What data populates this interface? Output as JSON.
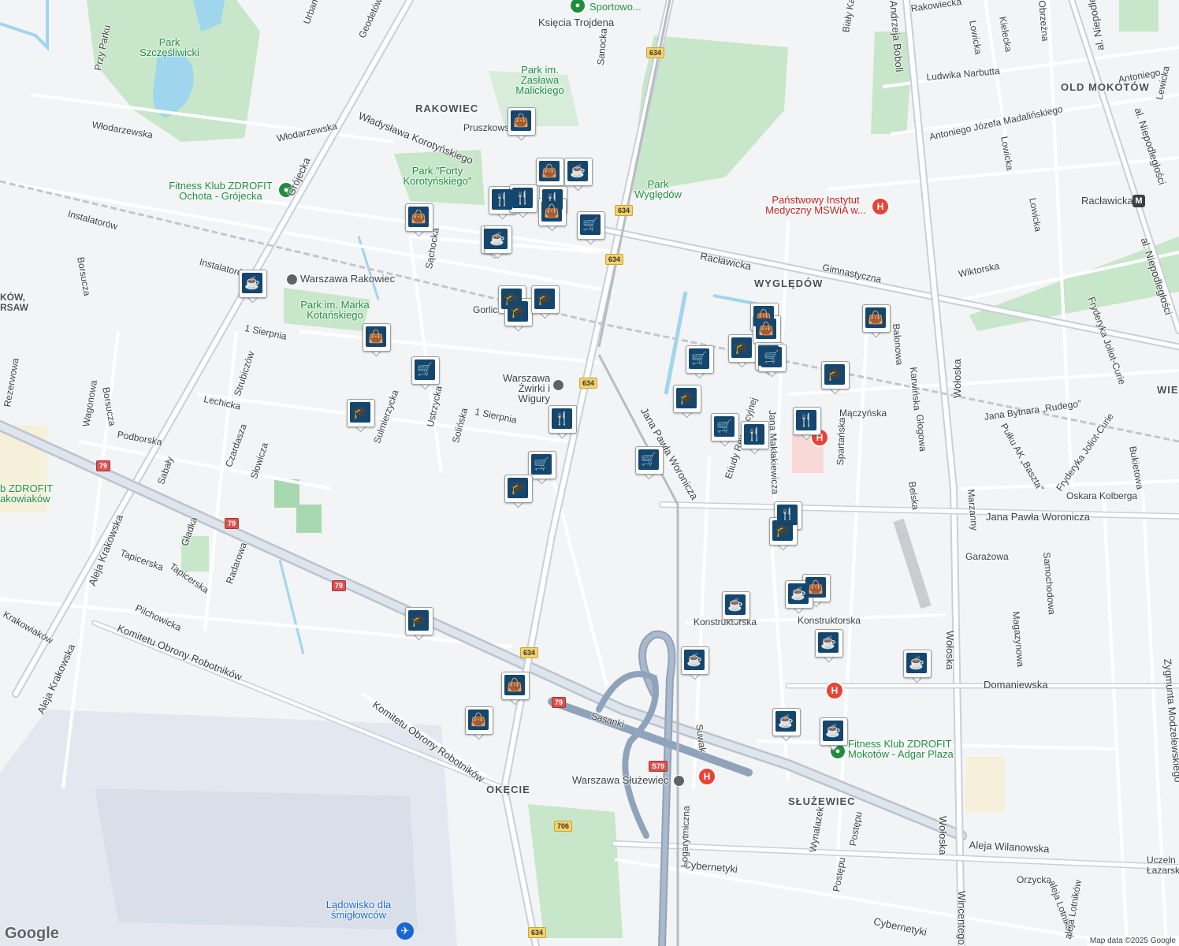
{
  "colors": {
    "background": "#f3f4f6",
    "park": "#c8e6c9",
    "water": "#9fd6ee",
    "road": "#ffffff",
    "major_road": "#bcc6d2",
    "rail": "#b7bcc2",
    "marker": "#14466e",
    "airport": "#e6eaf2"
  },
  "district_labels": [
    "RAKOWIEC",
    "OLD MOKOTÓW",
    "WYGLĘDÓW",
    "SŁUŻEWIEC",
    "OKĘCIE",
    "WIE"
  ],
  "street_labels": [
    "Księcia Trojdena",
    "Przy Parku",
    "Urbana",
    "Geodetów",
    "Sanocka",
    "Pruszkowska",
    "Włodarzewska",
    "Władysława Korotyńskiego",
    "Grójecka",
    "Instalatorów",
    "Sąchocka",
    "Gorlicka",
    "1 Sierpnia",
    "Lechicka",
    "Podborska",
    "Sulmierzycka",
    "Ustrzycka",
    "Solińska",
    "Borsucza",
    "Wagonowa",
    "Rezerwowa",
    "Strubiczów",
    "Czardasza",
    "Słowicza",
    "Sabały",
    "Gładka",
    "Tapicerska",
    "Radarowa",
    "Pilchowicka",
    "Krakowiaków",
    "Aleja Krakowska",
    "Komitetu Obrony Robotników",
    "Sasanki",
    "Cybernetyki",
    "Logarytmiczna",
    "Suwak",
    "Konstruktorska",
    "Domaniewska",
    "Jana Pawła Woronicza",
    "Racławicka",
    "Gimnastyczna",
    "Wiktorska",
    "Ludwika Narbutta",
    "Antoniego Józefa Madalińskiego",
    "Andrzeja Boboli",
    "Wołoska",
    "al. Niepodległości",
    "Lowicka",
    "Kielecka",
    "Mączyńska",
    "Karwińska",
    "Balonowa",
    "Głogowa",
    "Jana Bytnara „Rudego”",
    "Pułku AK „Baszta”",
    "Fryderyka Joliot-Curie",
    "Oskara Kolberga",
    "Bukietowa",
    "Marzanny",
    "Samochodowa",
    "Magazynowa",
    "Zygmunta Modzelewskiego",
    "Garażowa",
    "Spartańska",
    "Belska",
    "Jana Makłakiewicza",
    "Etiudy Rewolucyjnej",
    "Wynalazek",
    "Postępu",
    "Aleja Wilanowska",
    "Orzycka",
    "aleja Lotników",
    "Wincentego",
    "Biały Kamień",
    "Rakowiecka",
    "Antoniego",
    "Lewicka",
    "Obrzeżna",
    "S79",
    "706",
    "79",
    "634"
  ],
  "parks": [
    "Park Szczęśliwicki",
    "Park im. Zasława Malickiego",
    "Park \"Forty Korotyńskiego\"",
    "Park Wyględów",
    "Park im. Marka Kotańskiego"
  ],
  "pois": {
    "fitness_1": "Fitness Klub ZDROFIT Ochota - Grójecka",
    "fitness_2": "Fitness Klub ZDROFIT Mokotów - Adgar Plaza",
    "fitness_3": "b ZDROFIT akowiaków",
    "institute": "Państwowy Instytut Medyczny MSWiA w...",
    "heliport": "Lądowisko dla śmigłowców",
    "sport": "Sportowo...",
    "racławicka_metro": "Racławicka",
    "fragment_left": "KÓW, RSAW",
    "uczelnia": "Uczeln Łazarski"
  },
  "stations": [
    "Warszawa Rakowiec",
    "Warszawa Żwirki i Wigury",
    "Warszawa Służewiec"
  ],
  "marker_icons": {
    "shopping": "shopping-bag-icon",
    "cafe": "coffee-cup-icon",
    "restaurant": "fork-knife-icon",
    "school": "graduation-cap-icon",
    "grocery": "shopping-cart-icon"
  },
  "attribution": "Map data ©2025 Google",
  "logo": "Google"
}
